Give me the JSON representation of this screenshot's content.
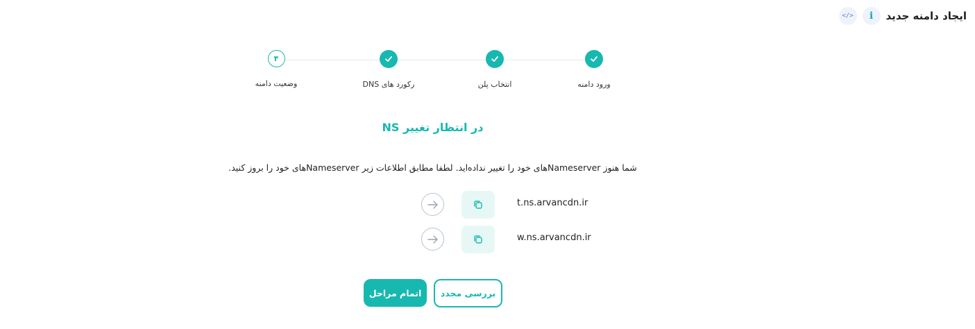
{
  "header": {
    "title": "ایجاد دامنه جدید",
    "info_icon": "info-icon",
    "info_glyph": "i",
    "code_icon": "code-icon",
    "code_glyph": "</>"
  },
  "stepper": {
    "steps": [
      {
        "label": "ورود دامنه",
        "status": "done"
      },
      {
        "label": "انتخاب پلن",
        "status": "done"
      },
      {
        "label": "رکورد های DNS",
        "status": "done"
      },
      {
        "label": "وضعیت دامنه",
        "status": "current",
        "number": "۴"
      }
    ]
  },
  "status": {
    "title": "در انتظار تغییر NS",
    "instructions": "شما هنوز Nameserverهای خود را تغییر نداده‌اید. لطفا مطابق اطلاعات زیر Nameserverهای خود را بروز کنید."
  },
  "nameservers": [
    {
      "value": "t.ns.arvancdn.ir",
      "copy_icon": "copy-icon",
      "arrow_icon": "arrow-right-icon"
    },
    {
      "value": "w.ns.arvancdn.ir",
      "copy_icon": "copy-icon",
      "arrow_icon": "arrow-right-icon"
    }
  ],
  "actions": {
    "finish_label": "اتمام مراحل",
    "recheck_label": "بررسی مجدد"
  },
  "colors": {
    "accent": "#17b8b0",
    "accent_light": "#e6f7f6",
    "icon_bg": "#eef3fb"
  }
}
